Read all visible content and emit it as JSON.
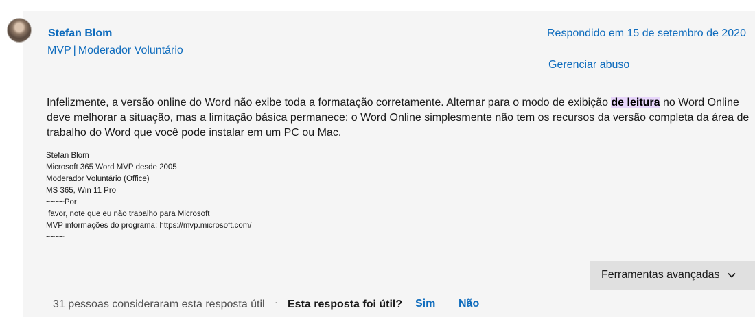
{
  "author": {
    "name": "Stefan Blom",
    "role_primary": "MVP",
    "role_separator": "|",
    "role_secondary": "Moderador Voluntário"
  },
  "reply": {
    "date_text": "Respondido em 15 de setembro de 2020",
    "report_label": "Gerenciar abuso"
  },
  "body": {
    "text_before": "Infelizmente, a versão online do Word não exibe toda a formatação corretamente. Alternar para o modo de exibição ",
    "highlighted": "de leitura",
    "text_after": " no Word Online deve melhorar a situação, mas a limitação básica permanece: o Word Online simplesmente não tem os recursos da versão completa da área de trabalho do Word que você pode instalar em um PC ou Mac."
  },
  "signature": {
    "lines": [
      "Stefan Blom",
      "Microsoft 365 Word MVP desde 2005",
      "Moderador Voluntário (Office)",
      "MS 365, Win 11 Pro",
      "~~~~Por",
      " favor, note que eu não trabalho para Microsoft",
      "MVP informações do programa: https://mvp.microsoft.com/",
      "~~~~"
    ]
  },
  "tools": {
    "advanced_label": "Ferramentas avançadas"
  },
  "footer": {
    "helpful_count_text": "31 pessoas consideraram esta resposta útil",
    "separator": "·",
    "question": "Esta resposta foi útil?",
    "yes_label": "Sim",
    "no_label": "Não"
  },
  "icons": {
    "avatar": "user-avatar-photo",
    "chevron": "chevron-down-icon"
  },
  "colors": {
    "link": "#0f6cbd",
    "panel_background": "#f5f5f5",
    "highlight": "#e8d6fb",
    "tools_button": "#e0e0e0"
  }
}
